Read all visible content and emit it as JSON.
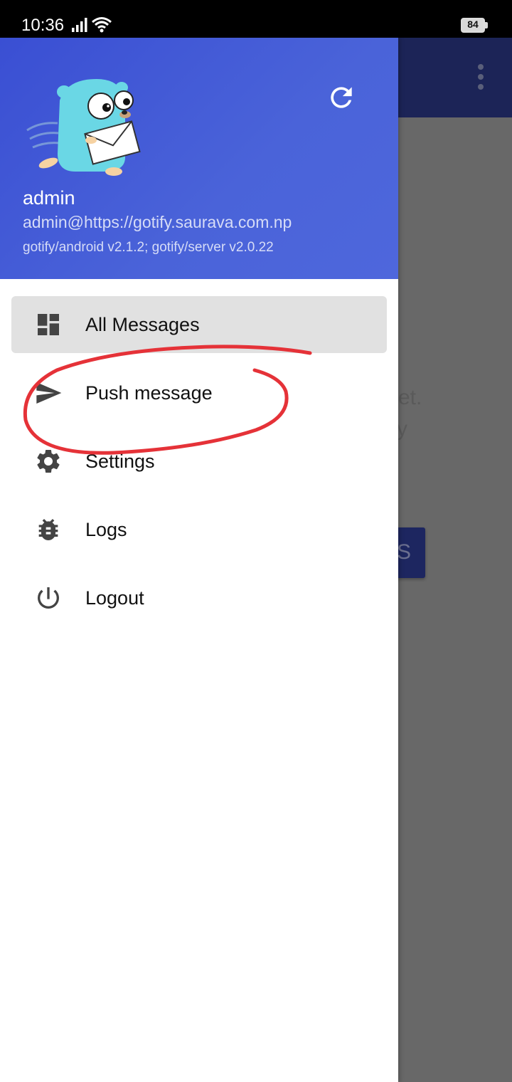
{
  "status_bar": {
    "time": "10:36",
    "battery": "84"
  },
  "header": {
    "user_name": "admin",
    "user_email": "admin@https://gotify.saurava.com.np",
    "versions": "gotify/android v2.1.2; gotify/server v2.0.22"
  },
  "menu": {
    "items": [
      {
        "label": "All Messages",
        "icon": "dashboard-icon",
        "active": true
      },
      {
        "label": "Push message",
        "icon": "send-icon"
      },
      {
        "label": "Settings",
        "icon": "gear-icon"
      },
      {
        "label": "Logs",
        "icon": "bug-icon"
      },
      {
        "label": "Logout",
        "icon": "power-icon"
      }
    ]
  },
  "background": {
    "text_line1": "et.",
    "text_line2": "y",
    "button_text": "S"
  },
  "colors": {
    "header_gradient_start": "#3a4fd3",
    "header_gradient_end": "#4e67dc",
    "active_item": "#e1e1e1",
    "annotation": "#e53238"
  }
}
